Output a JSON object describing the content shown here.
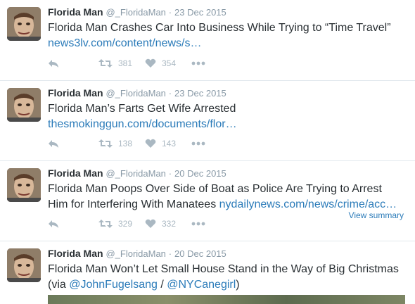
{
  "tweets": [
    {
      "name": "Florida Man",
      "handle": "@_FloridaMan",
      "sep": "·",
      "date": "23 Dec 2015",
      "text": "Florida Man Crashes Car Into Business While Trying to “Time Travel”",
      "link": "news3lv.com/content/news/s…",
      "retweets": "381",
      "likes": "354"
    },
    {
      "name": "Florida Man",
      "handle": "@_FloridaMan",
      "sep": "·",
      "date": "23 Dec 2015",
      "text": "Florida Man’s Farts Get Wife Arrested",
      "link": "thesmokinggun.com/documents/flor…",
      "retweets": "138",
      "likes": "143"
    },
    {
      "name": "Florida Man",
      "handle": "@_FloridaMan",
      "sep": "·",
      "date": "20 Dec 2015",
      "text_line1": "Florida Man Poops Over Side of Boat as Police Are Trying to Arrest",
      "text_line2": "Him for Interfering With Manatees",
      "link": "nydailynews.com/news/crime/acc…",
      "retweets": "329",
      "likes": "332",
      "view_summary": "View summary"
    },
    {
      "name": "Florida Man",
      "handle": "@_FloridaMan",
      "sep": "·",
      "date": "20 Dec 2015",
      "text_line1": "Florida Man Won’t Let Small House Stand in the Way of Big Christmas",
      "text_prefix": "(via ",
      "mention1": "@JohnFugelsang",
      "mention_sep": " / ",
      "mention2": "@NYCanegirl",
      "text_suffix": ")"
    }
  ],
  "icons": {
    "reply": "reply-icon",
    "retweet": "retweet-icon",
    "like": "heart-icon",
    "more": "more-icon"
  },
  "colors": {
    "link": "#2b7bb9",
    "muted": "#8899a6",
    "action": "#aab8c2",
    "text": "#292f33"
  }
}
